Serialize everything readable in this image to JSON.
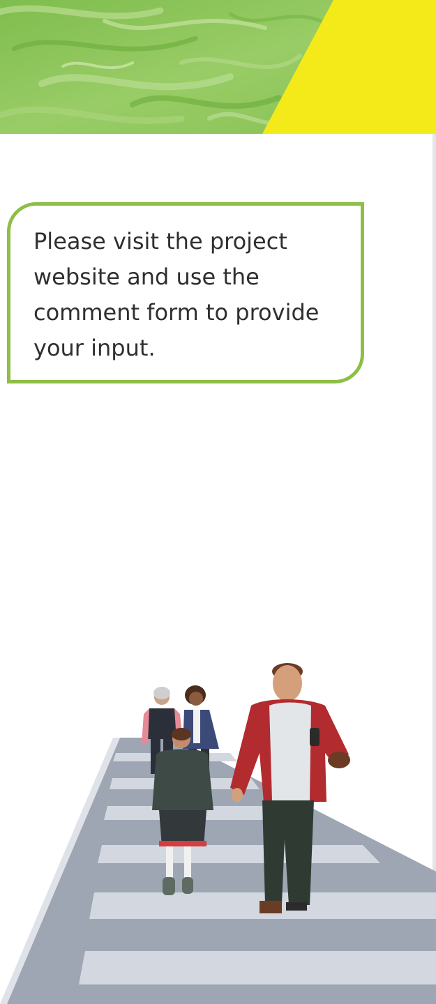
{
  "callout": {
    "text": "Please visit the project website and use the comment form to provide your input."
  },
  "banner": {
    "green_color": "#8cc45b",
    "yellow_color": "#f4ea1a"
  },
  "illustration": {
    "subject": "pedestrians-crossing"
  }
}
